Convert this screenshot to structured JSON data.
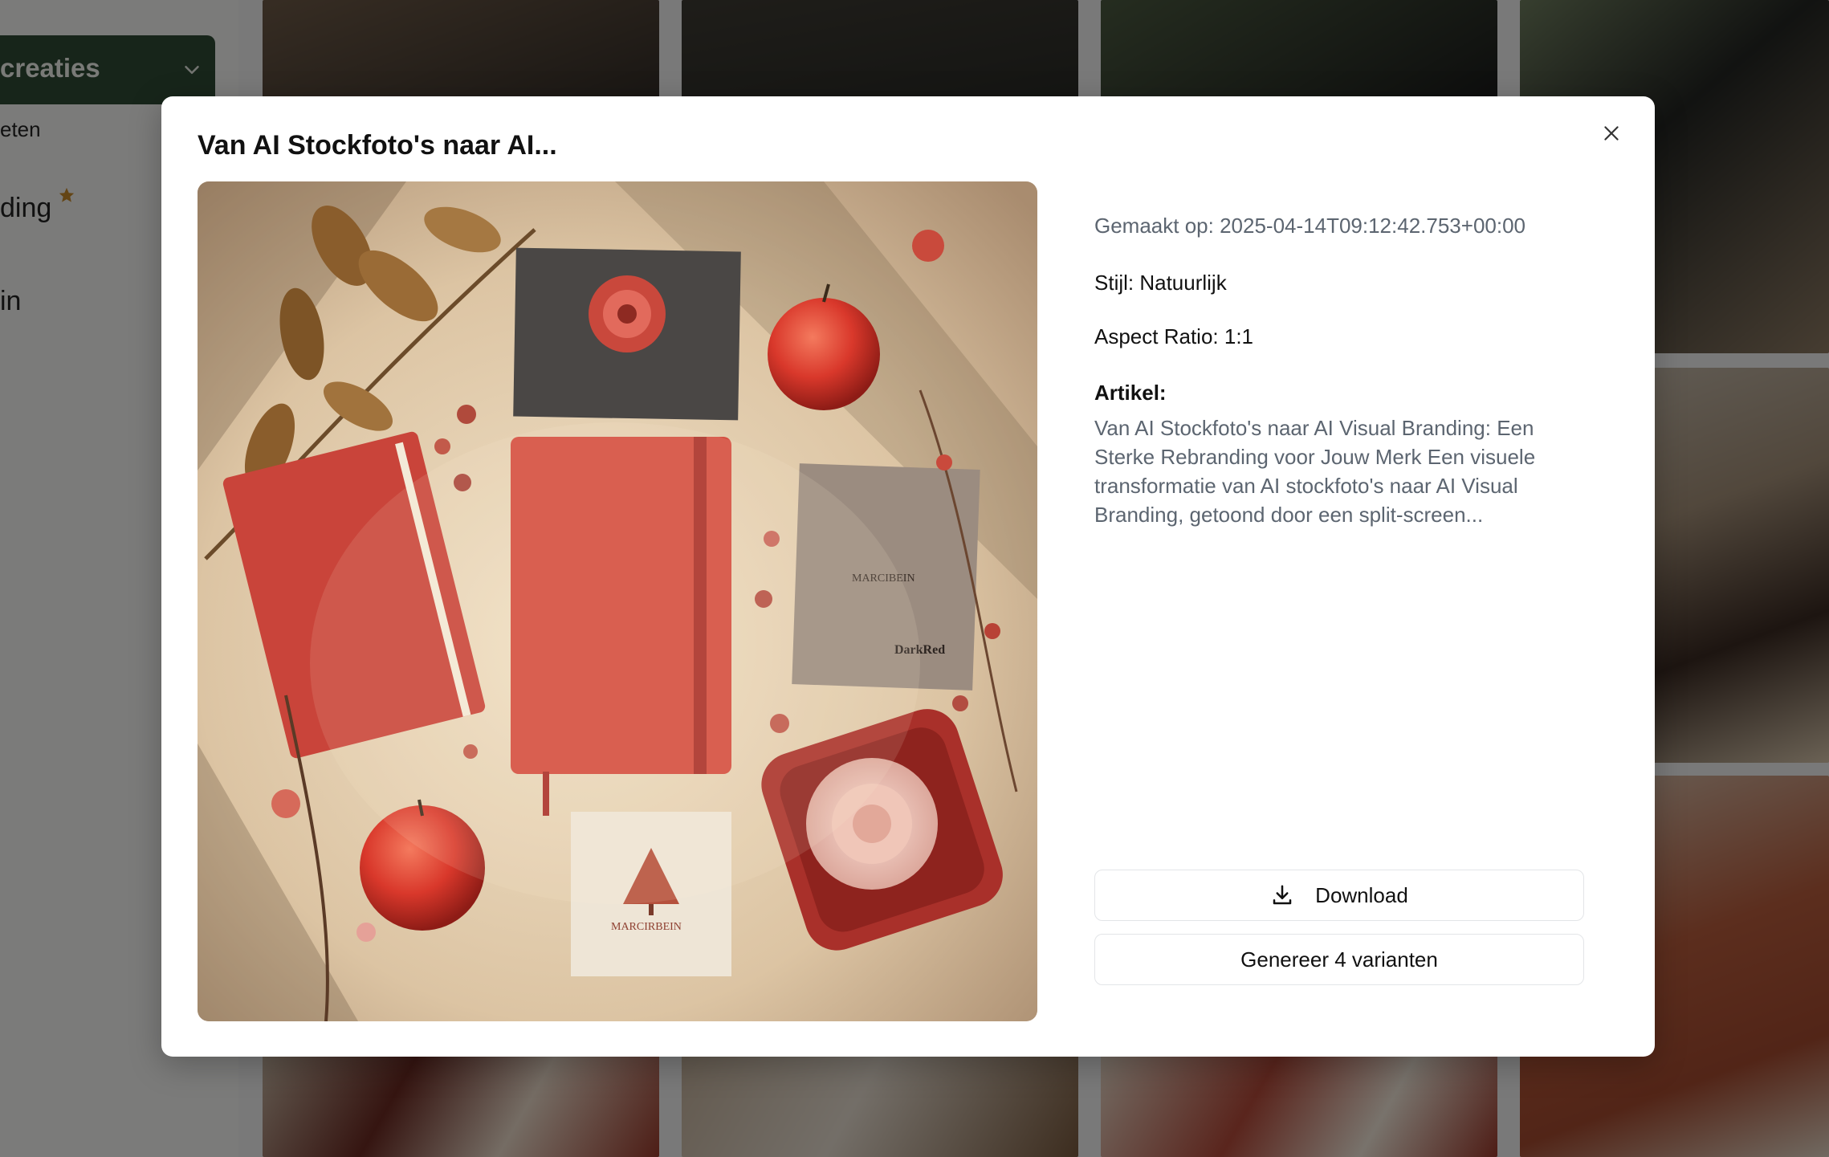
{
  "sidebar": {
    "creaties_label": "creaties",
    "item_1": "eten",
    "item_2": "ding",
    "item_3": "in"
  },
  "modal": {
    "title": "Van AI Stockfoto's naar AI...",
    "created": "Gemaakt op: 2025-04-14T09:12:42.753+00:00",
    "style": "Stijl: Natuurlijk",
    "aspect": "Aspect Ratio: 1:1",
    "artikel_label": "Artikel:",
    "artikel_text": "Van AI Stockfoto's naar AI Visual Branding: Een Sterke Rebranding voor Jouw Merk Een visuele transformatie van AI stockfoto's naar AI Visual Branding, getoond door een split-screen...",
    "download_label": "Download",
    "variants_label": "Genereer 4 varianten"
  },
  "preview_image": {
    "card_text_1": "MARCIRBEIN",
    "card_text_2": "MARCIBEIN",
    "card_text_3": "DarkRed"
  },
  "colors": {
    "sidebar_accent": "#2f4a35",
    "star": "#c98a2b",
    "muted_text": "#5c6570"
  },
  "icons": {
    "close": "close-icon",
    "download": "download-icon",
    "chevron": "chevron-down-icon",
    "star": "star-icon"
  }
}
